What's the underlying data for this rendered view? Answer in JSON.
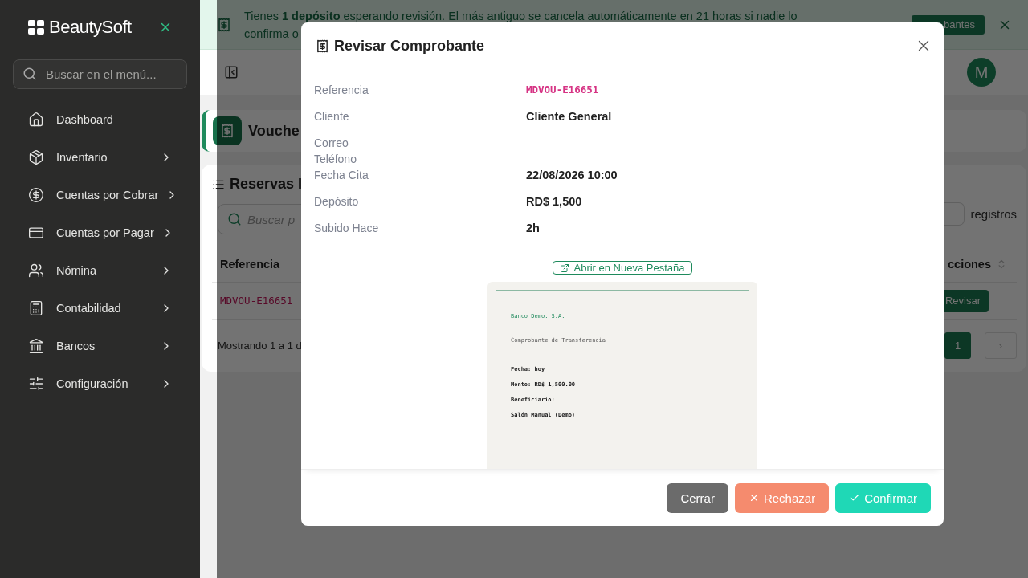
{
  "sidebar": {
    "logo": "BeautySoft",
    "search": {
      "placeholder": "Buscar en el menú..."
    },
    "items": [
      {
        "label": "Dashboard",
        "kind": "home",
        "has_children": false
      },
      {
        "label": "Inventario",
        "kind": "box",
        "has_children": true
      },
      {
        "label": "Cuentas por Cobrar",
        "kind": "dollar",
        "has_children": true
      },
      {
        "label": "Cuentas por Pagar",
        "kind": "card",
        "has_children": true
      },
      {
        "label": "Nómina",
        "kind": "users",
        "has_children": true
      },
      {
        "label": "Contabilidad",
        "kind": "calculator",
        "has_children": true
      },
      {
        "label": "Bancos",
        "kind": "bank",
        "has_children": true
      },
      {
        "label": "Configuración",
        "kind": "sliders",
        "has_children": true
      }
    ]
  },
  "banner": {
    "line_1": "Tienes **1 depósito** esperando revisión. El más antiguo se cancela automáticamente en 21 horas si nadie lo",
    "line_2": "confirma o",
    "button": "bantes"
  },
  "topbar": {
    "avatar": "M"
  },
  "page_header": {
    "title": "Vouche"
  },
  "list_card": {
    "title": "Reservas I",
    "search": {
      "placeholder": "Buscar p"
    },
    "page_size_label": "registros",
    "columns": [
      "Referencia",
      "cciones"
    ],
    "rows": [
      {
        "reference": "MDVOU-E16651",
        "action": "Revisar"
      }
    ],
    "footer": "Mostrando 1 a 1 d",
    "pages": [
      {
        "label": "1",
        "selected": true
      },
      {
        "label": "›",
        "selected": false
      }
    ]
  },
  "modal": {
    "title": "Revisar Comprobante",
    "details": [
      {
        "label": "Referencia",
        "value": "MDVOU-E16651",
        "kind": "code"
      },
      {
        "label": "Cliente",
        "value": "Cliente General",
        "kind": "text"
      },
      {
        "label": "Correo",
        "kind": "text"
      },
      {
        "label": "Teléfono",
        "kind": "text"
      },
      {
        "label": "Fecha Cita",
        "value": "22/08/2026 10:00",
        "kind": "text"
      },
      {
        "label": "Depósito",
        "value": "RD$ 1,500",
        "kind": "text"
      },
      {
        "label": "Subido Hace",
        "value": "2h",
        "kind": "text"
      }
    ],
    "open_link": "Abrir en Nueva Pestaña",
    "voucher": {
      "bank": "Banco Demo. S.A.",
      "subtitle": "Comprobante de Transferencia",
      "lines": [
        "Fecha: hoy",
        "Monto: RD$ 1,500.00",
        "Beneficiario:",
        "Salón Manual (Demo)"
      ]
    },
    "buttons": [
      {
        "label": "Cerrar",
        "kind": "close"
      },
      {
        "label": "Rechazar",
        "kind": "reject"
      },
      {
        "label": "Confirmar",
        "kind": "confirm"
      }
    ]
  }
}
